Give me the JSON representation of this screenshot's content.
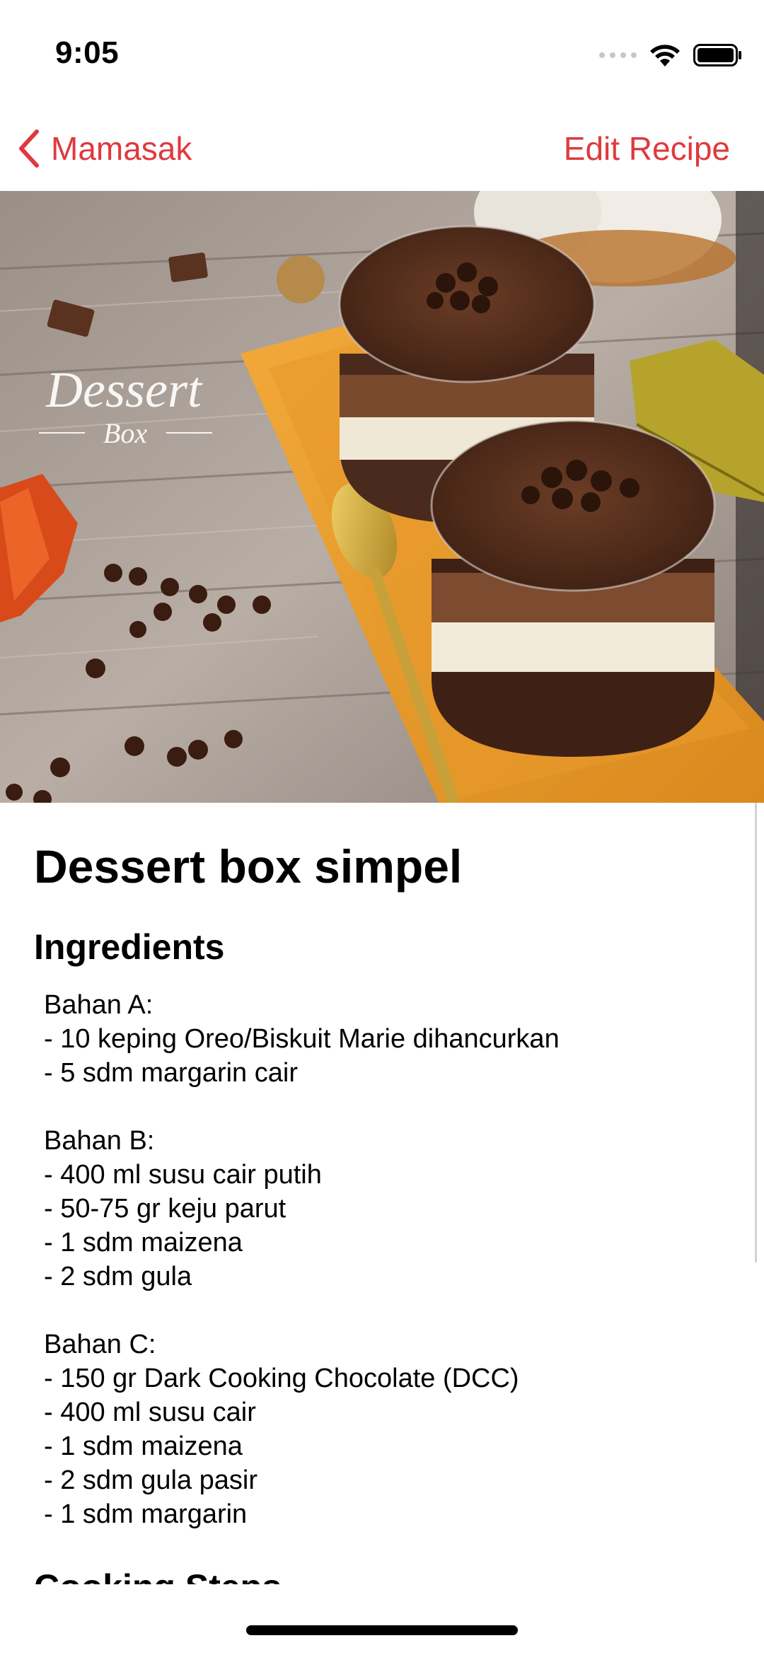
{
  "status_bar": {
    "time": "9:05",
    "icons": [
      "cellular-signal-icon",
      "wifi-icon",
      "battery-icon"
    ]
  },
  "nav": {
    "back_label": "Mamasak",
    "edit_label": "Edit Recipe",
    "tint_color": "#e0393e"
  },
  "hero_image": {
    "watermark_line1": "Dessert",
    "watermark_line2": "Box"
  },
  "recipe": {
    "title": "Dessert box simpel",
    "ingredients_heading": "Ingredients",
    "ingredients_text": "Bahan A:\n- 10 keping Oreo/Biskuit Marie dihancurkan\n- 5 sdm margarin cair\n\nBahan B:\n- 400 ml susu cair putih\n- 50-75 gr keju parut\n- 1 sdm maizena\n- 2 sdm gula\n\nBahan C:\n- 150 gr Dark Cooking Chocolate (DCC)\n- 400 ml susu cair\n- 1 sdm maizena\n- 2 sdm gula pasir\n- 1 sdm margarin",
    "steps_heading": "Cooking Steps"
  }
}
